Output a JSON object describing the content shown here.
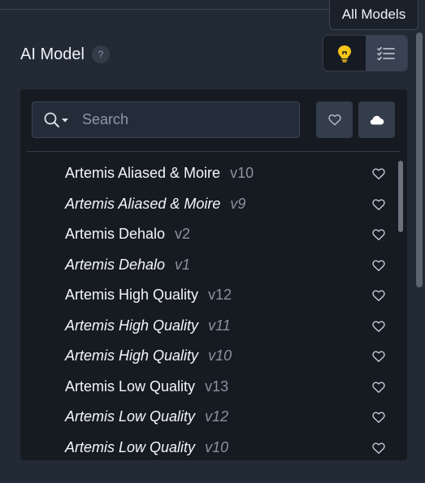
{
  "tooltip": {
    "label": "All Models"
  },
  "header": {
    "title": "AI Model",
    "help_symbol": "?"
  },
  "view_toggle": {
    "options": [
      {
        "icon": "lightbulb-icon",
        "color": "#f5c518",
        "active": false
      },
      {
        "icon": "list-icon",
        "color": "#c9d0da",
        "active": true
      }
    ]
  },
  "search": {
    "placeholder": "Search",
    "value": ""
  },
  "filters": {
    "favorites_icon": "heart-icon",
    "cloud_icon": "cloud-icon"
  },
  "models": [
    {
      "name": "Artemis Aliased & Moire",
      "version": "v10",
      "italic": false
    },
    {
      "name": "Artemis Aliased & Moire",
      "version": "v9",
      "italic": true
    },
    {
      "name": "Artemis Dehalo",
      "version": "v2",
      "italic": false
    },
    {
      "name": "Artemis Dehalo",
      "version": "v1",
      "italic": true
    },
    {
      "name": "Artemis High Quality",
      "version": "v12",
      "italic": false
    },
    {
      "name": "Artemis High Quality",
      "version": "v11",
      "italic": true
    },
    {
      "name": "Artemis High Quality",
      "version": "v10",
      "italic": true
    },
    {
      "name": "Artemis Low Quality",
      "version": "v13",
      "italic": false
    },
    {
      "name": "Artemis Low Quality",
      "version": "v12",
      "italic": true
    },
    {
      "name": "Artemis Low Quality",
      "version": "v10",
      "italic": true
    }
  ],
  "colors": {
    "background": "#222a36",
    "panel": "#161b22",
    "accent": "#f5c518",
    "text": "#f4f6fa",
    "muted": "#8a93a1"
  }
}
